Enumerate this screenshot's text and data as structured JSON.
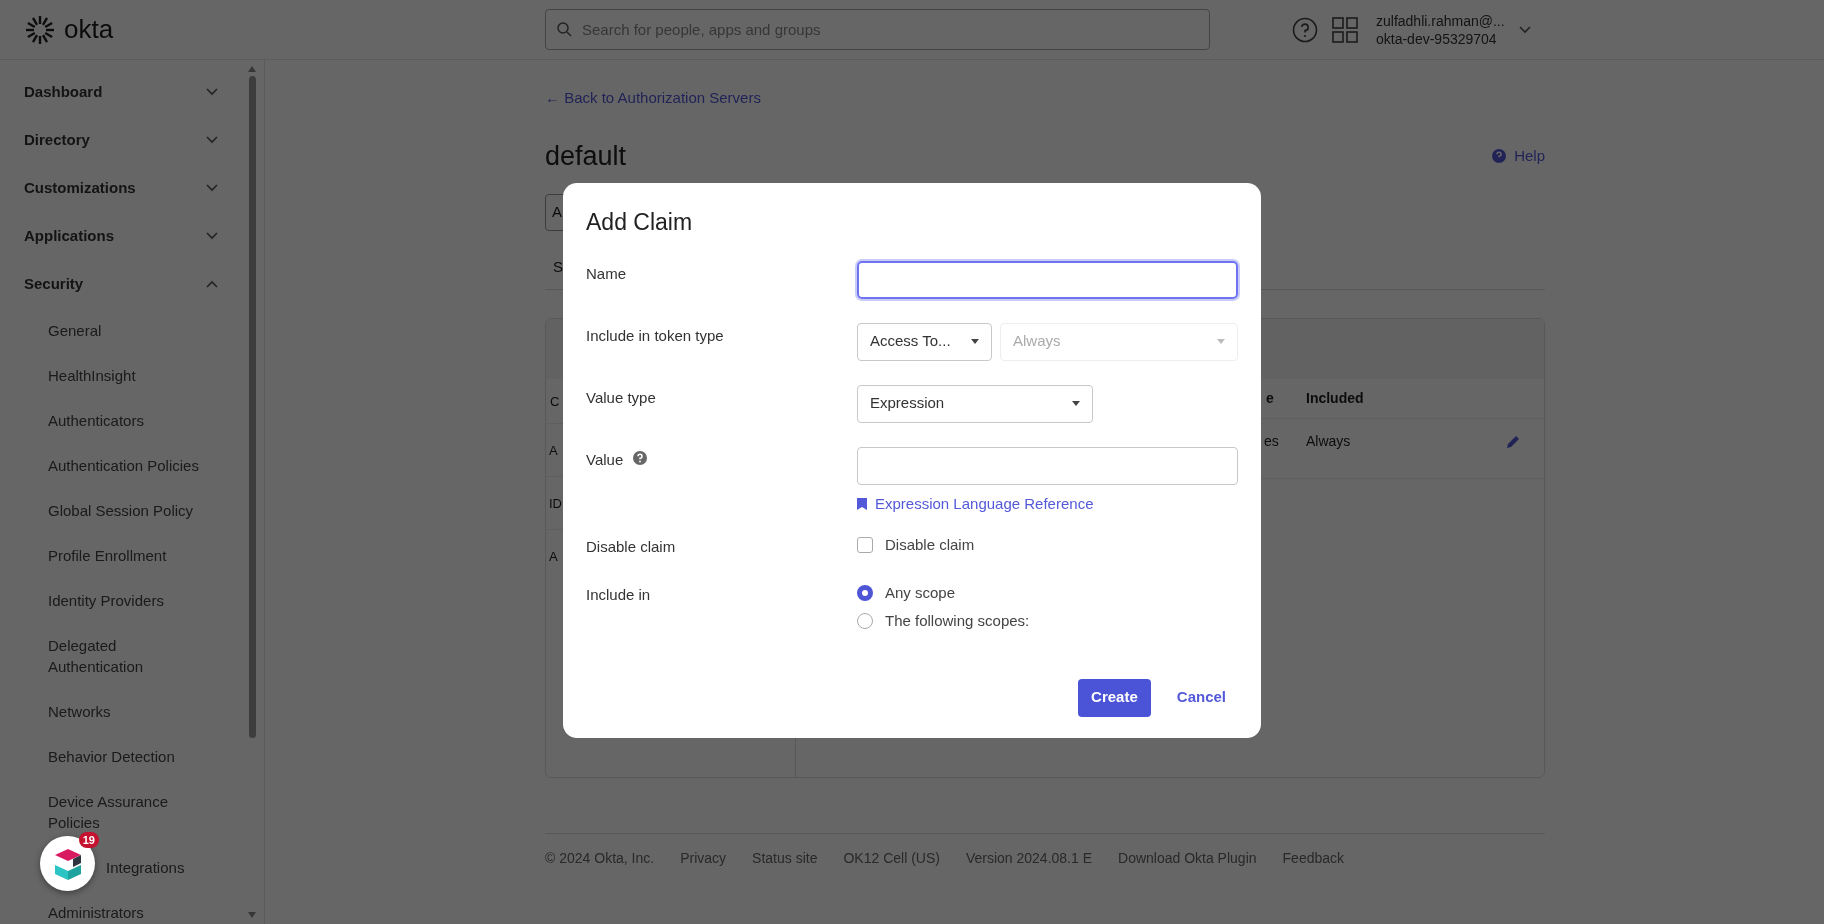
{
  "header": {
    "logo": "okta",
    "search": {
      "placeholder": "Search for people, apps and groups"
    },
    "user": {
      "name": "zulfadhli.rahman@...",
      "org": "okta-dev-95329704"
    }
  },
  "sidebar": {
    "items": [
      {
        "label": "Dashboard",
        "expanded": false
      },
      {
        "label": "Directory",
        "expanded": false
      },
      {
        "label": "Customizations",
        "expanded": false
      },
      {
        "label": "Applications",
        "expanded": false
      },
      {
        "label": "Security",
        "expanded": true,
        "children": [
          {
            "label": "General",
            "covered": false
          },
          {
            "label": "HealthInsight",
            "covered": false
          },
          {
            "label": "Authenticators",
            "covered": false
          },
          {
            "label": "Authentication Policies",
            "covered": false
          },
          {
            "label": "Global Session Policy",
            "covered": false
          },
          {
            "label": "Profile Enrollment",
            "covered": false
          },
          {
            "label": "Identity Providers",
            "covered": false
          },
          {
            "label": "Delegated Authentication",
            "covered": false
          },
          {
            "label": "Networks",
            "covered": false
          },
          {
            "label": "Behavior Detection",
            "covered": false
          },
          {
            "label": "Device Assurance Policies",
            "covered": false
          },
          {
            "label": "Integrations",
            "covered": true
          },
          {
            "label": "Administrators",
            "covered": false
          }
        ]
      }
    ]
  },
  "page": {
    "back_link": "← Back to Authorization Servers",
    "title": "default",
    "help": "Help",
    "tab_button": "A",
    "tab": "S",
    "list": [
      "A",
      "ID",
      "A"
    ],
    "list_header": "C",
    "table": {
      "columns": [
        "e",
        "Included"
      ],
      "rows": [
        [
          "es",
          "Always"
        ]
      ]
    }
  },
  "modal": {
    "title": "Add Claim",
    "fields": [
      {
        "kind": "text",
        "label": "Name",
        "focused": true
      },
      {
        "kind": "token",
        "label": "Include in token type",
        "selects": [
          {
            "value": "Access To...",
            "disabled": false
          },
          {
            "value": "Always",
            "disabled": true
          }
        ]
      },
      {
        "kind": "select",
        "label": "Value type",
        "selects": [
          {
            "value": "Expression",
            "disabled": false
          }
        ]
      },
      {
        "kind": "expression",
        "label": "Value",
        "link": "Expression Language Reference",
        "focused": false
      },
      {
        "kind": "checkbox",
        "label": "Disable claim",
        "option": "Disable claim",
        "checked": false
      },
      {
        "kind": "radio",
        "label": "Include in",
        "options": [
          {
            "label": "Any scope",
            "selected": true
          },
          {
            "label": "The following scopes:",
            "selected": false
          }
        ]
      }
    ],
    "buttons": [
      {
        "kind": "primary",
        "label": "Create"
      },
      {
        "kind": "link",
        "label": "Cancel"
      }
    ]
  },
  "footer": [
    "© 2024 Okta, Inc.",
    "Privacy",
    "Status site",
    "OK12 Cell (US)",
    "Version 2024.08.1 E",
    "Download Okta Plugin",
    "Feedback"
  ],
  "widget": {
    "badge": "19"
  }
}
